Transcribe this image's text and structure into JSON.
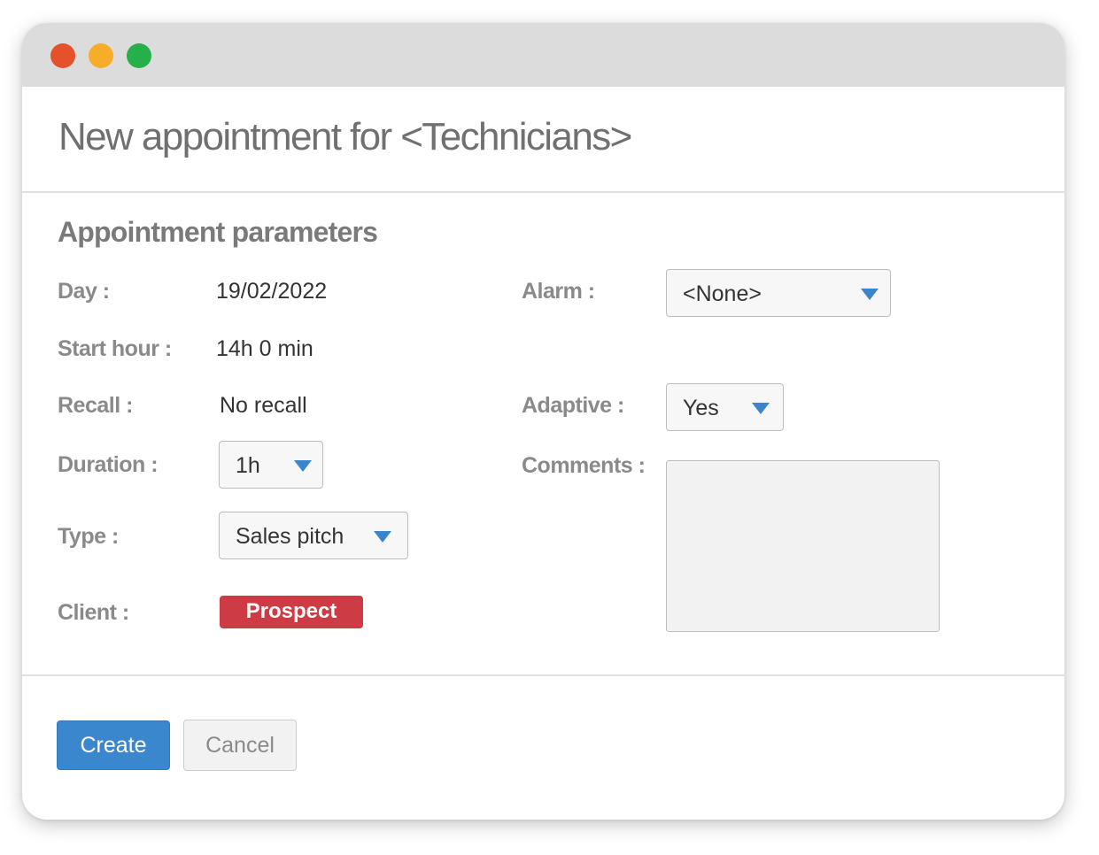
{
  "window": {
    "controls": [
      "close",
      "minimize",
      "maximize"
    ]
  },
  "header": {
    "title": "New appointment for <Technicians>"
  },
  "section": {
    "title": "Appointment parameters"
  },
  "fields": {
    "day": {
      "label": "Day :",
      "value": "19/02/2022"
    },
    "start_hour": {
      "label": "Start hour :",
      "value": "14h 0 min"
    },
    "recall": {
      "label": "Recall :",
      "value": "No recall"
    },
    "duration": {
      "label": "Duration :",
      "value": "1h"
    },
    "type": {
      "label": "Type :",
      "value": "Sales pitch"
    },
    "client": {
      "label": "Client :",
      "value": "Prospect",
      "badge_color": "#cd3b45"
    },
    "alarm": {
      "label": "Alarm :",
      "value": "<None>"
    },
    "adaptive": {
      "label": "Adaptive :",
      "value": "Yes"
    },
    "comments": {
      "label": "Comments :",
      "value": ""
    }
  },
  "actions": {
    "create_label": "Create",
    "cancel_label": "Cancel"
  },
  "colors": {
    "accent": "#3a87cd",
    "caret": "#3a85cc",
    "prospect": "#cd3b45",
    "dot_red": "#e5512b",
    "dot_yellow": "#f7ac2a",
    "dot_green": "#25b04a"
  }
}
